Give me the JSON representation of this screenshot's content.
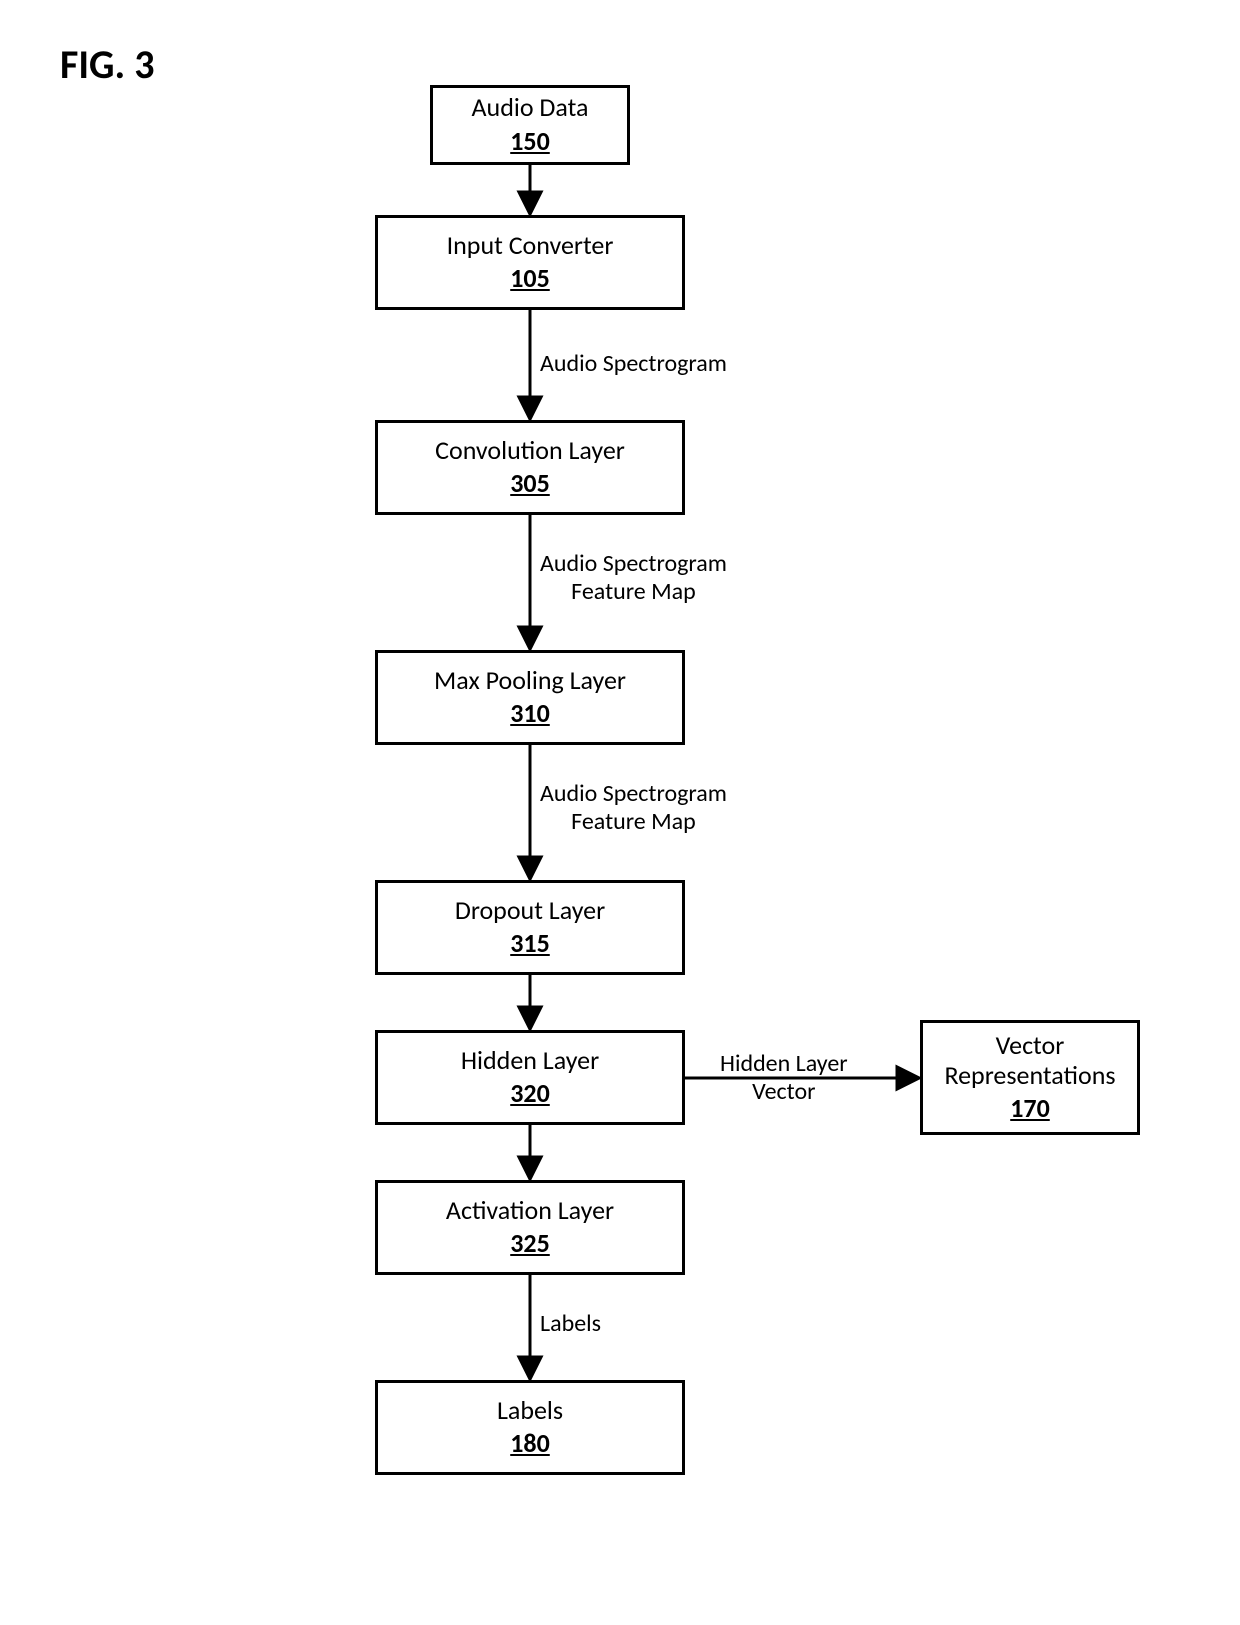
{
  "figure": {
    "label": "FIG. 3"
  },
  "nodes": {
    "audio_data": {
      "title": "Audio Data",
      "ref": "150"
    },
    "input_converter": {
      "title": "Input Converter",
      "ref": "105"
    },
    "convolution_layer": {
      "title": "Convolution Layer",
      "ref": "305"
    },
    "max_pooling": {
      "title": "Max Pooling Layer",
      "ref": "310"
    },
    "dropout": {
      "title": "Dropout Layer",
      "ref": "315"
    },
    "hidden": {
      "title": "Hidden Layer",
      "ref": "320"
    },
    "activation": {
      "title": "Activation Layer",
      "ref": "325"
    },
    "labels": {
      "title": "Labels",
      "ref": "180"
    },
    "vector_reps": {
      "title": "Vector\nRepresentations",
      "ref": "170"
    }
  },
  "edges": {
    "e1": "Audio Spectrogram",
    "e2": "Audio Spectrogram\nFeature Map",
    "e3": "Audio Spectrogram\nFeature Map",
    "e4": "Hidden Layer\nVector",
    "e5": "Labels"
  }
}
